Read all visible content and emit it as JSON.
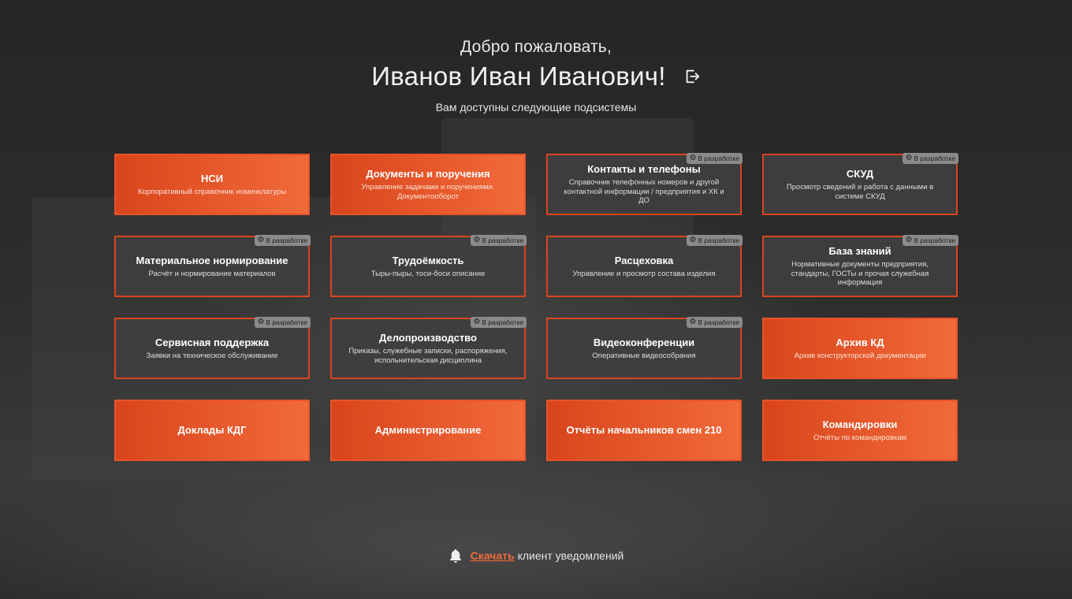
{
  "header": {
    "welcome": "Добро пожаловать,",
    "user_name": "Иванов Иван Иванович!",
    "logout_icon": "logout-icon",
    "subtitle": "Вам доступны следующие подсистемы"
  },
  "badge_label": "В разработке",
  "colors": {
    "accent": "#e8532a",
    "accent_light": "#f16a3a",
    "tile_dark": "#3e3e3e",
    "badge": "#8a8a8a"
  },
  "tiles": [
    {
      "title": "НСИ",
      "desc": "Корпоративный справочник номенклатуры",
      "style": "orange",
      "dev": false
    },
    {
      "title": "Документы и поручения",
      "desc": "Управление задачами и поручениями. Документооборот",
      "style": "orange",
      "dev": false
    },
    {
      "title": "Контакты и телефоны",
      "desc": "Справочник телефонных номеров и другой контактной информации / предприятия и ХК и ДО",
      "style": "dark",
      "dev": true
    },
    {
      "title": "СКУД",
      "desc": "Просмотр сведений и работа с данными в системе СКУД",
      "style": "dark",
      "dev": true
    },
    {
      "title": "Материальное нормирование",
      "desc": "Расчёт и нормирование материалов",
      "style": "dark",
      "dev": true
    },
    {
      "title": "Трудоёмкость",
      "desc": "Тыры-пыры, тоси-боси описание",
      "style": "dark",
      "dev": true
    },
    {
      "title": "Расцеховка",
      "desc": "Управление и просмотр состава изделия",
      "style": "dark",
      "dev": true
    },
    {
      "title": "База знаний",
      "desc": "Нормативные документы предприятия, стандарты, ГОСТы и прочая служебная информация",
      "style": "dark",
      "dev": true
    },
    {
      "title": "Сервисная поддержка",
      "desc": "Заявки на техническое обслуживание",
      "style": "dark",
      "dev": true
    },
    {
      "title": "Делопроизводство",
      "desc": "Приказы, служебные записки, распоряжения, испольнительская дисциплина",
      "style": "dark",
      "dev": true
    },
    {
      "title": "Видеоконференции",
      "desc": "Оперативные видеособрания",
      "style": "dark",
      "dev": true
    },
    {
      "title": "Архив КД",
      "desc": "Архив конструкторской документации",
      "style": "orange",
      "dev": false
    },
    {
      "title": "Доклады КДГ",
      "desc": "",
      "style": "orange",
      "dev": false
    },
    {
      "title": "Администрирование",
      "desc": "",
      "style": "orange",
      "dev": false
    },
    {
      "title": "Отчёты начальников смен 210",
      "desc": "",
      "style": "orange",
      "dev": false
    },
    {
      "title": "Командировки",
      "desc": "Отчёты по командировкам",
      "style": "orange",
      "dev": false
    }
  ],
  "footer": {
    "bell_icon": "bell-icon",
    "link_label": "Скачать",
    "text": "клиент уведомлений"
  }
}
